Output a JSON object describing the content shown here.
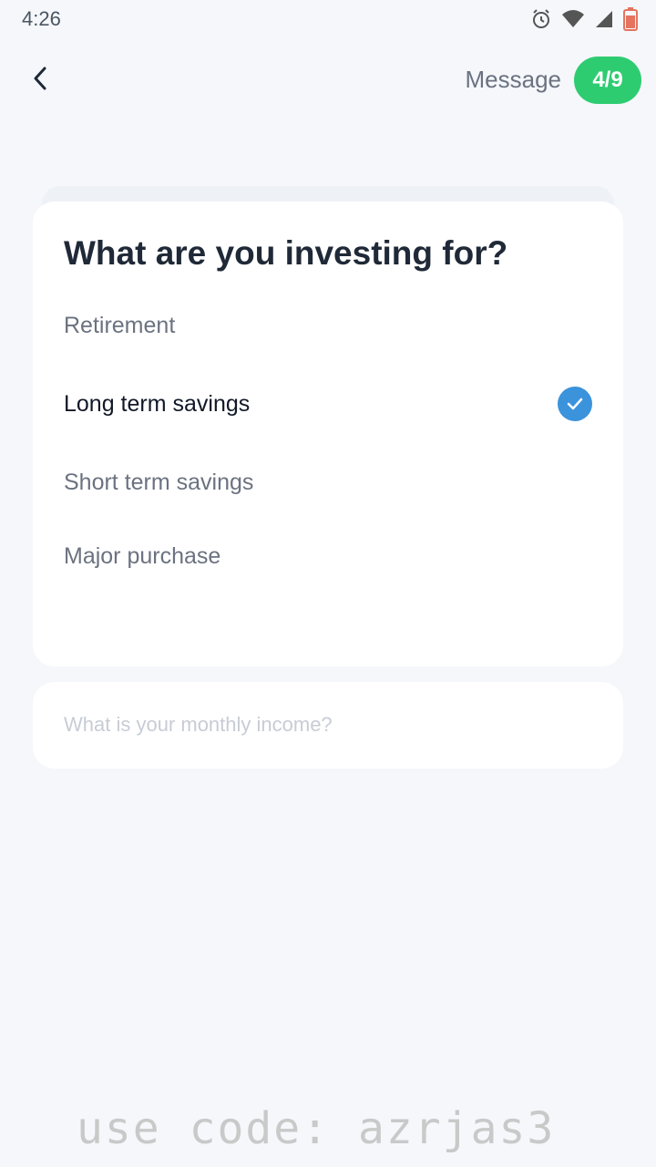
{
  "status_bar": {
    "time": "4:26",
    "icons": [
      "alarm-icon",
      "wifi-icon",
      "signal-icon",
      "battery-icon"
    ]
  },
  "header": {
    "message_label": "Message",
    "progress": "4/9",
    "progress_color": "#2ecc71"
  },
  "question": {
    "title": "What are you investing for?",
    "options": [
      {
        "label": "Retirement",
        "selected": false
      },
      {
        "label": "Long term savings",
        "selected": true
      },
      {
        "label": "Short term savings",
        "selected": false
      },
      {
        "label": "Major purchase",
        "selected": false
      }
    ]
  },
  "next_question": {
    "title": "What is your monthly income?"
  },
  "footer": {
    "promo": "use code: azrjas3"
  },
  "colors": {
    "background": "#f5f7fb",
    "accent": "#3b93dc",
    "badge": "#2ecc71"
  }
}
